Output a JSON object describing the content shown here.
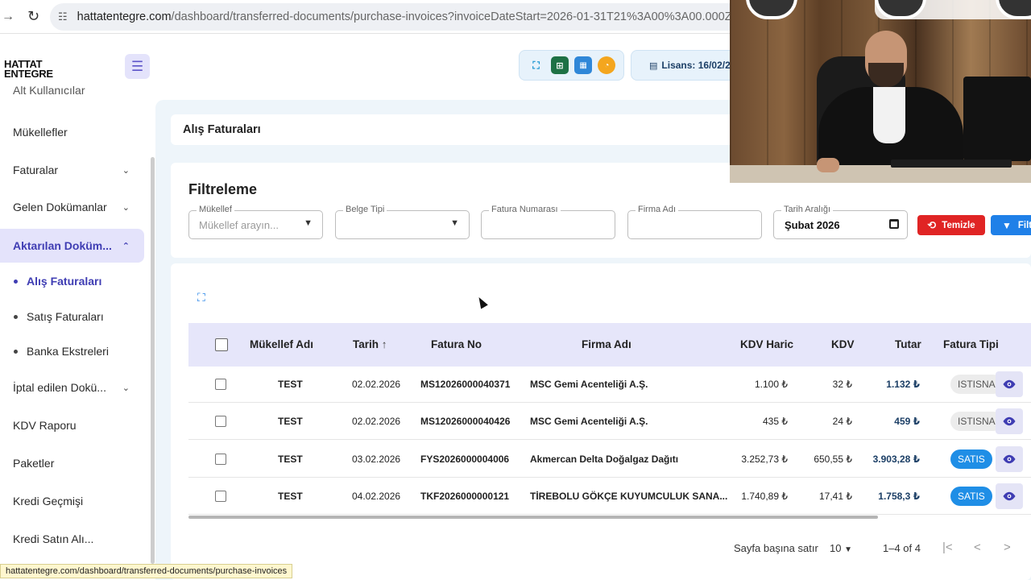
{
  "browser": {
    "url_host": "hattatentegre.com",
    "url_path": "/dashboard/transferred-documents/purchase-invoices?invoiceDateStart=2026-01-31T21%3A00%3A00.000Z&invoiceDateE",
    "status_url": "hattatentegre.com/dashboard/transferred-documents/purchase-invoices"
  },
  "header": {
    "logo_line1": "HATTAT",
    "logo_line2": "ENTEGRE",
    "license": "Lisans: 16/02/20"
  },
  "sidebar": {
    "items": [
      {
        "label": "Alt Kullanıcılar"
      },
      {
        "label": "Mükellefler"
      },
      {
        "label": "Faturalar"
      },
      {
        "label": "Gelen Dokümanlar"
      },
      {
        "label": "Aktarılan Doküm..."
      },
      {
        "label": "İptal edilen Dokü..."
      },
      {
        "label": "KDV Raporu"
      },
      {
        "label": "Paketler"
      },
      {
        "label": "Kredi Geçmişi"
      },
      {
        "label": "Kredi Satın Alı..."
      }
    ],
    "subitems": [
      {
        "label": "Alış Faturaları"
      },
      {
        "label": "Satış Faturaları"
      },
      {
        "label": "Banka Ekstreleri"
      }
    ]
  },
  "page": {
    "title": "Alış Faturaları"
  },
  "filter": {
    "title": "Filtreleme",
    "mukellef_label": "Mükellef",
    "mukellef_placeholder": "Mükellef arayın...",
    "belge_label": "Belge Tipi",
    "fatura_no_label": "Fatura Numarası",
    "firma_label": "Firma Adı",
    "tarih_label": "Tarih Aralığı",
    "tarih_value": "Şubat 2026",
    "clear_button": "Temizle",
    "filter_button": "Filt"
  },
  "table": {
    "columns": [
      "Mükellef Adı",
      "Tarih",
      "Fatura No",
      "Firma Adı",
      "KDV Haric",
      "KDV",
      "Tutar",
      "Fatura Tipi"
    ],
    "rows": [
      {
        "mukellef": "TEST",
        "tarih": "02.02.2026",
        "fatura_no": "MS12026000040371",
        "firma": "MSC Gemi Acenteliği A.Ş.",
        "kdv_haric": "1.100 ₺",
        "kdv": "32 ₺",
        "tutar": "1.132 ₺",
        "tip": "ISTISNA",
        "tip_style": "gray"
      },
      {
        "mukellef": "TEST",
        "tarih": "02.02.2026",
        "fatura_no": "MS12026000040426",
        "firma": "MSC Gemi Acenteliği A.Ş.",
        "kdv_haric": "435 ₺",
        "kdv": "24 ₺",
        "tutar": "459 ₺",
        "tip": "ISTISNA",
        "tip_style": "gray"
      },
      {
        "mukellef": "TEST",
        "tarih": "03.02.2026",
        "fatura_no": "FYS2026000004006",
        "firma": "Akmercan Delta Doğalgaz Dağıtı",
        "kdv_haric": "3.252,73 ₺",
        "kdv": "650,55 ₺",
        "tutar": "3.903,28 ₺",
        "tip": "SATIS",
        "tip_style": "blue"
      },
      {
        "mukellef": "TEST",
        "tarih": "04.02.2026",
        "fatura_no": "TKF2026000000121",
        "firma": "TİREBOLU GÖKÇE KUYUMCULUK SANA...",
        "kdv_haric": "1.740,89 ₺",
        "kdv": "17,41 ₺",
        "tutar": "1.758,3 ₺",
        "tip": "SATIS",
        "tip_style": "blue"
      }
    ]
  },
  "pagination": {
    "rows_per_page_label": "Sayfa başına satır",
    "rows_per_page": "10",
    "range": "1–4 of 4"
  },
  "colors": {
    "accent": "#3f3db3",
    "clear": "#e02424",
    "filter": "#1f80e8"
  }
}
